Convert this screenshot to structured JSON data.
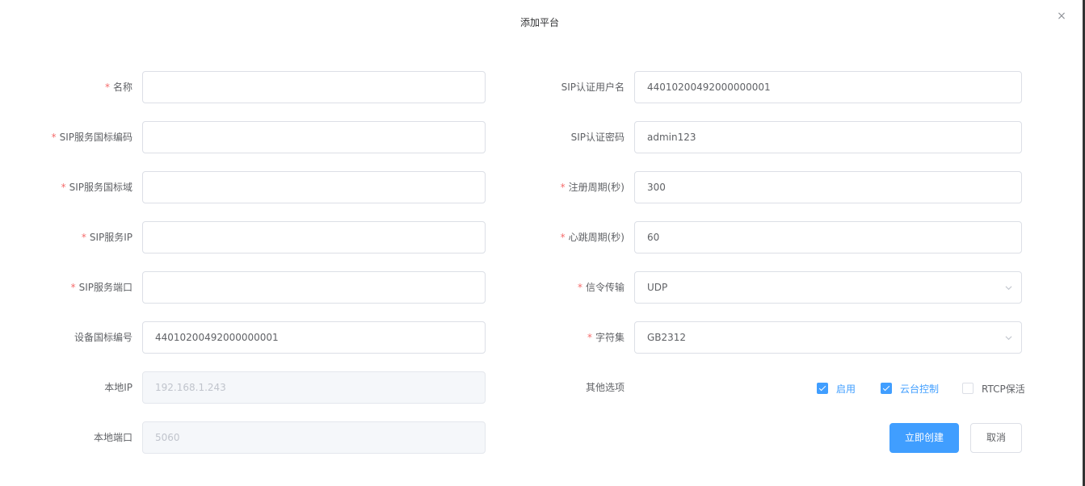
{
  "dialog": {
    "title": "添加平台",
    "close_glyph": "×",
    "close_icon": "close-icon"
  },
  "left": {
    "name": {
      "required": true,
      "label": "名称",
      "value": ""
    },
    "sip_id": {
      "required": true,
      "label": "SIP服务国标编码",
      "value": ""
    },
    "sip_domain": {
      "required": true,
      "label": "SIP服务国标域",
      "value": ""
    },
    "sip_ip": {
      "required": true,
      "label": "SIP服务IP",
      "value": ""
    },
    "sip_port": {
      "required": true,
      "label": "SIP服务端口",
      "value": ""
    },
    "device_gb_id": {
      "required": false,
      "label": "设备国标编号",
      "value": "44010200492000000001"
    },
    "local_ip": {
      "required": false,
      "label": "本地IP",
      "value": "192.168.1.243"
    },
    "local_port": {
      "required": false,
      "label": "本地端口",
      "value": "5060"
    }
  },
  "right": {
    "sip_username": {
      "required": false,
      "label": "SIP认证用户名",
      "value": "44010200492000000001"
    },
    "sip_password": {
      "required": false,
      "label": "SIP认证密码",
      "value": "admin123"
    },
    "register_period": {
      "required": true,
      "label": "注册周期(秒)",
      "value": "300"
    },
    "keepalive_period": {
      "required": true,
      "label": "心跳周期(秒)",
      "value": "60"
    },
    "transport": {
      "required": true,
      "label": "信令传输",
      "value": "UDP",
      "icon": "chevron-down-icon"
    },
    "charset": {
      "required": true,
      "label": "字符集",
      "value": "GB2312",
      "icon": "chevron-down-icon"
    },
    "other_options": {
      "label": "其他选项",
      "enable": {
        "label": "启用",
        "checked": true
      },
      "ptz": {
        "label": "云台控制",
        "checked": true
      },
      "rtcp": {
        "label": "RTCP保活",
        "checked": false
      }
    }
  },
  "actions": {
    "create_label": "立即创建",
    "cancel_label": "取消"
  },
  "colors": {
    "primary": "#409eff",
    "required": "#f56c6c",
    "border": "#dcdfe6",
    "disabled_bg": "#f5f7fa"
  }
}
